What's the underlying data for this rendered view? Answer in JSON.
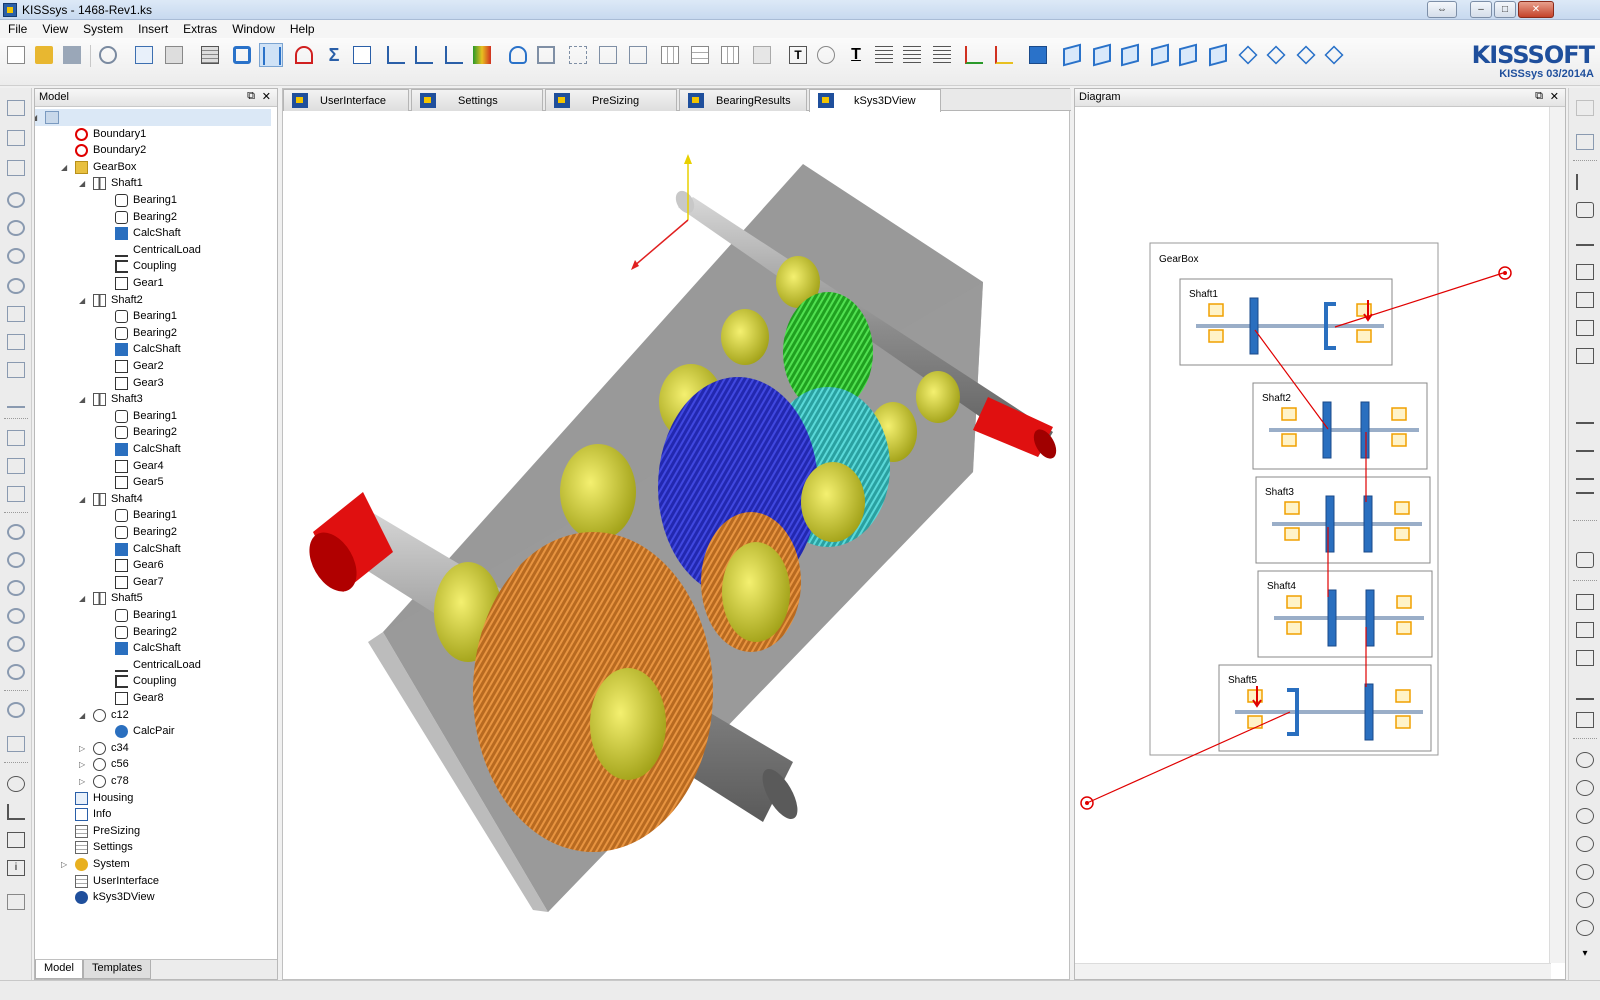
{
  "window": {
    "title": "KISSsys - 1468-Rev1.ks"
  },
  "menu": [
    "File",
    "View",
    "System",
    "Insert",
    "Extras",
    "Window",
    "Help"
  ],
  "brand": {
    "logo": "KISSSOFT",
    "version": "KISSsys 03/2014A"
  },
  "model_panel": {
    "title": "Model",
    "tree": [
      {
        "label": "",
        "level": 0,
        "icon": "root-icon",
        "expanded": true
      },
      {
        "label": "Boundary1",
        "level": 1,
        "icon": "boundary-icon"
      },
      {
        "label": "Boundary2",
        "level": 1,
        "icon": "boundary-icon"
      },
      {
        "label": "GearBox",
        "level": 1,
        "icon": "folder-icon",
        "expanded": true
      },
      {
        "label": "Shaft1",
        "level": 2,
        "icon": "shaft-icon",
        "expanded": true
      },
      {
        "label": "Bearing1",
        "level": 3,
        "icon": "bearing-icon"
      },
      {
        "label": "Bearing2",
        "level": 3,
        "icon": "bearing-icon"
      },
      {
        "label": "CalcShaft",
        "level": 3,
        "icon": "calcshaft-icon"
      },
      {
        "label": "CentricalLoad",
        "level": 3,
        "icon": "load-icon"
      },
      {
        "label": "Coupling",
        "level": 3,
        "icon": "coupling-icon"
      },
      {
        "label": "Gear1",
        "level": 3,
        "icon": "gear-icon"
      },
      {
        "label": "Shaft2",
        "level": 2,
        "icon": "shaft-icon",
        "expanded": true
      },
      {
        "label": "Bearing1",
        "level": 3,
        "icon": "bearing-icon"
      },
      {
        "label": "Bearing2",
        "level": 3,
        "icon": "bearing-icon"
      },
      {
        "label": "CalcShaft",
        "level": 3,
        "icon": "calcshaft-icon"
      },
      {
        "label": "Gear2",
        "level": 3,
        "icon": "gear-icon"
      },
      {
        "label": "Gear3",
        "level": 3,
        "icon": "gear-icon"
      },
      {
        "label": "Shaft3",
        "level": 2,
        "icon": "shaft-icon",
        "expanded": true
      },
      {
        "label": "Bearing1",
        "level": 3,
        "icon": "bearing-icon"
      },
      {
        "label": "Bearing2",
        "level": 3,
        "icon": "bearing-icon"
      },
      {
        "label": "CalcShaft",
        "level": 3,
        "icon": "calcshaft-icon"
      },
      {
        "label": "Gear4",
        "level": 3,
        "icon": "gear-icon"
      },
      {
        "label": "Gear5",
        "level": 3,
        "icon": "gear-icon"
      },
      {
        "label": "Shaft4",
        "level": 2,
        "icon": "shaft-icon",
        "expanded": true
      },
      {
        "label": "Bearing1",
        "level": 3,
        "icon": "bearing-icon"
      },
      {
        "label": "Bearing2",
        "level": 3,
        "icon": "bearing-icon"
      },
      {
        "label": "CalcShaft",
        "level": 3,
        "icon": "calcshaft-icon"
      },
      {
        "label": "Gear6",
        "level": 3,
        "icon": "gear-icon"
      },
      {
        "label": "Gear7",
        "level": 3,
        "icon": "gear-icon"
      },
      {
        "label": "Shaft5",
        "level": 2,
        "icon": "shaft-icon",
        "expanded": true
      },
      {
        "label": "Bearing1",
        "level": 3,
        "icon": "bearing-icon"
      },
      {
        "label": "Bearing2",
        "level": 3,
        "icon": "bearing-icon"
      },
      {
        "label": "CalcShaft",
        "level": 3,
        "icon": "calcshaft-icon"
      },
      {
        "label": "CentricalLoad",
        "level": 3,
        "icon": "load-icon"
      },
      {
        "label": "Coupling",
        "level": 3,
        "icon": "coupling-icon"
      },
      {
        "label": "Gear8",
        "level": 3,
        "icon": "gear-icon"
      },
      {
        "label": "c12",
        "level": 2,
        "icon": "pair-icon",
        "expanded": true
      },
      {
        "label": "CalcPair",
        "level": 3,
        "icon": "calcpair-icon"
      },
      {
        "label": "c34",
        "level": 2,
        "icon": "pair-icon",
        "expanded": false
      },
      {
        "label": "c56",
        "level": 2,
        "icon": "pair-icon",
        "expanded": false
      },
      {
        "label": "c78",
        "level": 2,
        "icon": "pair-icon",
        "expanded": false
      },
      {
        "label": "Housing",
        "level": 1,
        "icon": "housing-icon"
      },
      {
        "label": "Info",
        "level": 1,
        "icon": "info-icon"
      },
      {
        "label": "PreSizing",
        "level": 1,
        "icon": "table-icon"
      },
      {
        "label": "Settings",
        "level": 1,
        "icon": "table-icon"
      },
      {
        "label": "System",
        "level": 1,
        "icon": "system-icon",
        "expanded": false
      },
      {
        "label": "UserInterface",
        "level": 1,
        "icon": "table-icon"
      },
      {
        "label": "kSys3DView",
        "level": 1,
        "icon": "view3d-icon"
      }
    ],
    "bottom_tabs": [
      {
        "label": "Model",
        "active": true
      },
      {
        "label": "Templates",
        "active": false
      }
    ]
  },
  "doc_tabs": [
    {
      "label": "UserInterface",
      "active": false
    },
    {
      "label": "Settings",
      "active": false
    },
    {
      "label": "PreSizing",
      "active": false
    },
    {
      "label": "BearingResults",
      "active": false
    },
    {
      "label": "kSys3DView",
      "active": true
    }
  ],
  "diagram": {
    "title": "Diagram",
    "gearbox_label": "GearBox",
    "shafts": [
      "Shaft1",
      "Shaft2",
      "Shaft3",
      "Shaft4",
      "Shaft5"
    ]
  },
  "colors": {
    "accent": "#1f4f9c",
    "load": "#e00000",
    "bearing": "#f0a000",
    "gear_blue": "#2a6fbf"
  }
}
